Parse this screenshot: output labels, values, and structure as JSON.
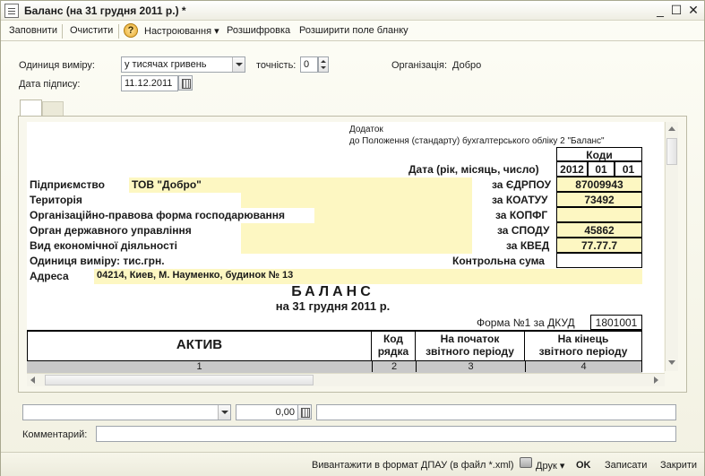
{
  "window": {
    "title": "Баланс (на 31 грудня 2011 р.) *",
    "minimize": "_",
    "maximize": "☐",
    "close": "✕"
  },
  "toolbar": {
    "fill": "Заповнити",
    "clear": "Очистити",
    "help": "?",
    "settings": "Настроювання",
    "decode": "Розшифровка",
    "expand": "Розширити поле бланку"
  },
  "form": {
    "unit_label": "Одиниця виміру:",
    "unit_value": "у тисячах гривень",
    "precision_label": "точність:",
    "precision_value": "0",
    "org_label": "Організація:",
    "org_value": "Добро",
    "date_label": "Дата підпису:",
    "date_value": "11.12.2011"
  },
  "report": {
    "annex_line1": "Додаток",
    "annex_line2": "до Положення (стандарту) бухгалтерського обліку 2 \"Баланс\"",
    "codes_header": "Коди",
    "date_label": "Дата (рік, місяць, число)",
    "date_year": "2012",
    "date_month": "01",
    "date_day": "01",
    "enterprise_label": "Підприємство",
    "enterprise_value": "ТОВ \"Добро\"",
    "edrpou_label": "за ЄДРПОУ",
    "edrpou_value": "87009943",
    "territory_label": "Територія",
    "koatuu_label": "за КОАТУУ",
    "koatuu_value": "73492",
    "legal_form_label": "Організаційно-правова форма господарювання",
    "kopfg_label": "за КОПФГ",
    "kopfg_value": "",
    "gov_label": "Орган державного управління",
    "spodu_label": "за СПОДУ",
    "spodu_value": "45862",
    "activity_label": "Вид економічної діяльності",
    "kved_label": "за КВЕД",
    "kved_value": "77.77.7",
    "unit_line": "Одиниця виміру: тис.грн.",
    "checksum_label": "Контрольна сума",
    "address_label": "Адреса",
    "address_value": "04214, Киев, М. Науменко, будинок № 13",
    "title": "БАЛАНС",
    "subtitle": "на 31 грудня 2011 р.",
    "form_label": "Форма №1 за ДКУД",
    "form_code": "1801001",
    "col_asset": "АКТИВ",
    "col_code_1": "Код",
    "col_code_2": "рядка",
    "col_start_1": "На початок",
    "col_start_2": "звітного періоду",
    "col_end_1": "На кінець",
    "col_end_2": "звітного періоду",
    "num_1": "1",
    "num_2": "2",
    "num_3": "3",
    "num_4": "4"
  },
  "bottom": {
    "amount_value": "0,00",
    "comment_label": "Комментарий:"
  },
  "statusbar": {
    "export": "Вивантажити в формат ДПАУ (в файл *.xml)",
    "print": "Друк",
    "ok": "OK",
    "save": "Записати",
    "close": "Закрити"
  },
  "colors": {
    "highlight_field": "#fdf7c2",
    "window_bg": "#f2f1e2"
  }
}
